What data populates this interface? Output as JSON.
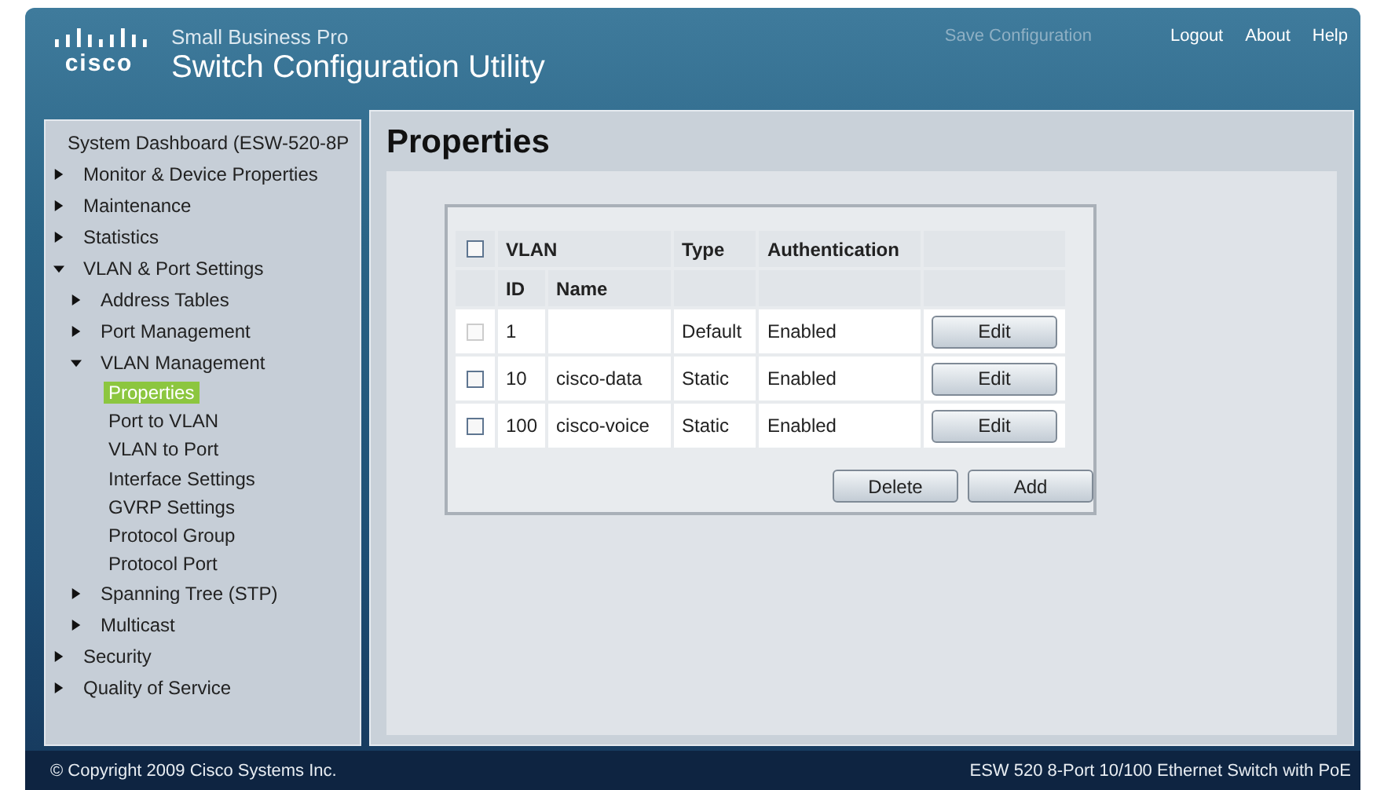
{
  "header": {
    "logo_text": "cisco",
    "product_line": "Small Business Pro",
    "title": "Switch Configuration Utility",
    "links": [
      {
        "label": "Save Configuration",
        "disabled": true
      },
      {
        "label": "Logout",
        "disabled": false
      },
      {
        "label": "About",
        "disabled": false
      },
      {
        "label": "Help",
        "disabled": false
      }
    ]
  },
  "sidebar": {
    "items": [
      {
        "label": "System Dashboard (ESW-520-8P",
        "kind": "page",
        "selected": false
      },
      {
        "label": "Monitor & Device Properties",
        "kind": "folder",
        "expanded": false,
        "selected": false
      },
      {
        "label": "Maintenance",
        "kind": "folder",
        "expanded": false,
        "selected": false
      },
      {
        "label": "Statistics",
        "kind": "folder",
        "expanded": false,
        "selected": false
      },
      {
        "label": "VLAN & Port Settings",
        "kind": "folder",
        "expanded": true,
        "selected": false,
        "children": [
          {
            "label": "Address Tables",
            "kind": "folder",
            "expanded": false,
            "selected": false
          },
          {
            "label": "Port Management",
            "kind": "folder",
            "expanded": false,
            "selected": false
          },
          {
            "label": "VLAN Management",
            "kind": "folder",
            "expanded": true,
            "selected": false,
            "children": [
              {
                "label": "Properties",
                "kind": "page",
                "selected": true
              },
              {
                "label": "Port to VLAN",
                "kind": "page",
                "selected": false
              },
              {
                "label": "VLAN to Port",
                "kind": "page",
                "selected": false
              },
              {
                "label": "Interface Settings",
                "kind": "page",
                "selected": false
              },
              {
                "label": "GVRP Settings",
                "kind": "page",
                "selected": false
              },
              {
                "label": "Protocol Group",
                "kind": "page",
                "selected": false
              },
              {
                "label": "Protocol Port",
                "kind": "page",
                "selected": false
              }
            ]
          },
          {
            "label": "Spanning Tree (STP)",
            "kind": "folder",
            "expanded": false,
            "selected": false
          },
          {
            "label": "Multicast",
            "kind": "folder",
            "expanded": false,
            "selected": false
          }
        ]
      },
      {
        "label": "Security",
        "kind": "folder",
        "expanded": false,
        "selected": false
      },
      {
        "label": "Quality of Service",
        "kind": "folder",
        "expanded": false,
        "selected": false
      }
    ]
  },
  "page_title": "Properties",
  "table": {
    "select_all": {
      "checked": false
    },
    "header_top": [
      "VLAN",
      "Type",
      "Authentication"
    ],
    "header_sub": [
      "ID",
      "Name"
    ],
    "rows": [
      {
        "checked": false,
        "disabled": true,
        "id": "1",
        "type": "Default",
        "authentication": "Enabled",
        "action": "Edit"
      },
      {
        "checked": false,
        "disabled": false,
        "id": "10",
        "name": "cisco-data",
        "type": "Static",
        "authentication": "Enabled",
        "action": "Edit"
      },
      {
        "checked": false,
        "disabled": false,
        "id": "100",
        "name": "cisco-voice",
        "type": "Static",
        "authentication": "Enabled",
        "action": "Edit"
      }
    ],
    "buttons": [
      "Delete",
      "Add"
    ]
  },
  "status_bar": {
    "copyright": "© Copyright 2009 Cisco Systems Inc.",
    "device": "ESW 520 8-Port 10/100 Ethernet Switch with PoE"
  }
}
